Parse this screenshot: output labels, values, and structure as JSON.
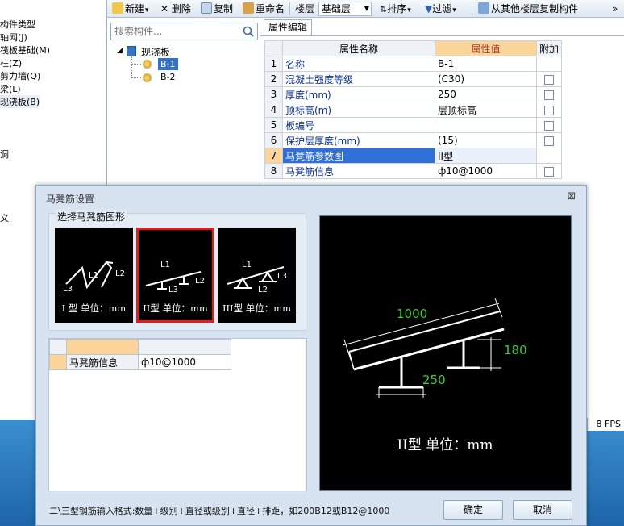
{
  "left_tree": {
    "items": [
      "构件类型",
      "轴网(J)",
      "筏板基础(M)",
      "柱(Z)",
      "剪力墙(Q)",
      "梁(L)",
      "现浇板(B)",
      "洞",
      "义"
    ]
  },
  "toolbar": {
    "new_label": "新建",
    "delete_label": "删除",
    "copy_label": "复制",
    "rename_label": "重命名",
    "floor_label": "楼层",
    "floor_value": "基础层",
    "sort_label": "排序",
    "filter_label": "过滤",
    "copy_from_floor_label": "从其他楼层复制构件",
    "more_label": "»"
  },
  "component_panel": {
    "search_placeholder": "搜索构件...",
    "tree_root": "现浇板",
    "tree_children": [
      "B-1",
      "B-2"
    ],
    "selected_child": "B-1"
  },
  "properties": {
    "tab_label": "属性编辑",
    "headers": {
      "name": "属性名称",
      "value": "属性值",
      "attach": "附加"
    },
    "rows": [
      {
        "no": "1",
        "name": "名称",
        "value": "B-1",
        "attach": false
      },
      {
        "no": "2",
        "name": "混凝土强度等级",
        "value": "(C30)",
        "attach": true
      },
      {
        "no": "3",
        "name": "厚度(mm)",
        "value": "250",
        "attach": true
      },
      {
        "no": "4",
        "name": "顶标高(m)",
        "value": "层顶标高",
        "attach": true
      },
      {
        "no": "5",
        "name": "板编号",
        "value": "",
        "attach": true
      },
      {
        "no": "6",
        "name": "保护层厚度(mm)",
        "value": "(15)",
        "attach": true
      },
      {
        "no": "7",
        "name": "马凳筋参数图",
        "value": "II型",
        "attach": false,
        "selected": true
      },
      {
        "no": "8",
        "name": "马凳筋信息",
        "value": "ф10@1000",
        "attach": true
      }
    ]
  },
  "status": {
    "fps": "8 FPS"
  },
  "dialog": {
    "title": "马凳筋设置",
    "close_glyph": "⊠",
    "shape_group_label": "选择马凳筋图形",
    "shapes": [
      {
        "caption": "I 型  单位：mm"
      },
      {
        "caption": "II型  单位：mm",
        "selected": true
      },
      {
        "caption": "III型  单位：mm"
      }
    ],
    "shape_labels": {
      "l1": "L1",
      "l2": "L2",
      "l3": "L3"
    },
    "info_table": {
      "row_label": "马凳筋信息",
      "row_value": "ф10@1000"
    },
    "preview": {
      "dim_top": "1000",
      "dim_right": "180",
      "dim_bottom": "250",
      "caption": "II型  单位：mm",
      "dim_color": "#39d12a"
    },
    "hint": "二\\三型钢筋输入格式:数量+级别+直径或级别+直径+排距，如200B12或B12@1000",
    "ok_label": "确定",
    "cancel_label": "取消"
  }
}
